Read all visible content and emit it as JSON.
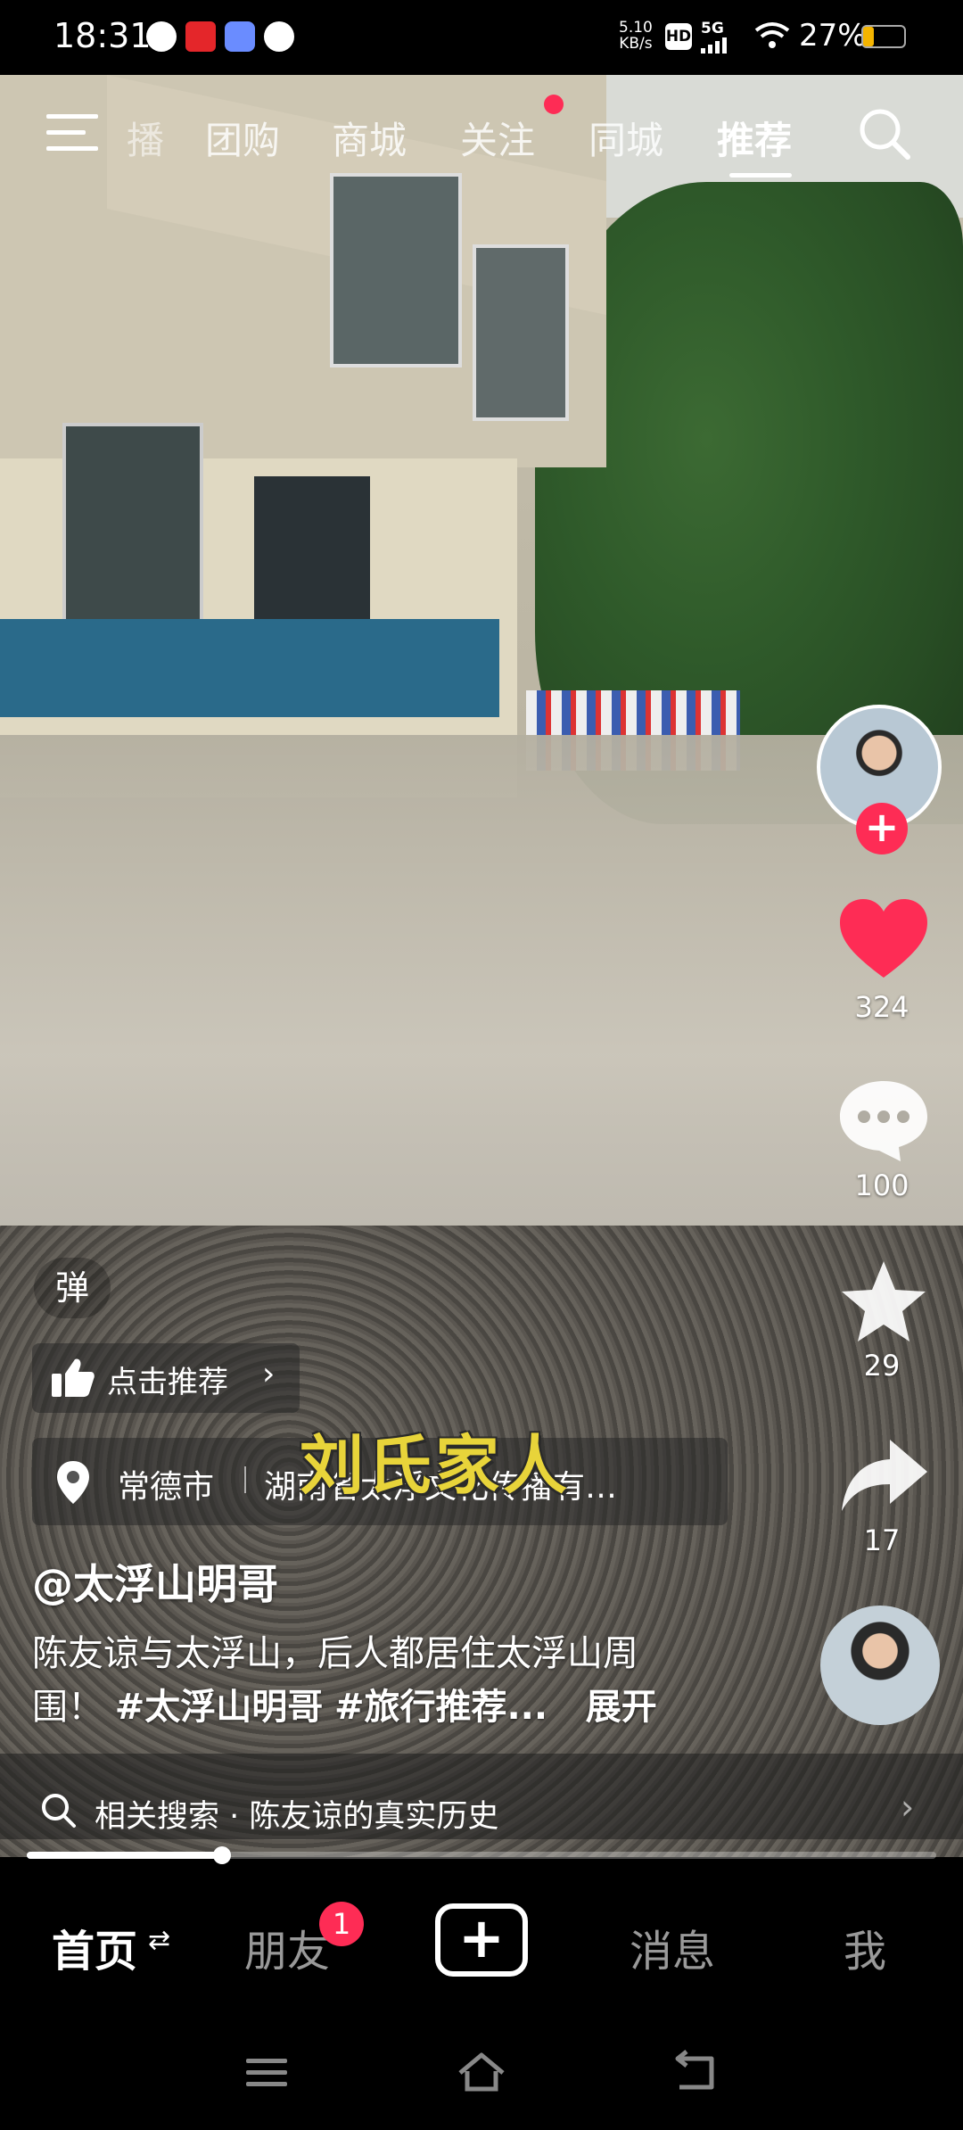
{
  "status_bar": {
    "time": "18:31",
    "net_speed_value": "5.10",
    "net_speed_unit": "KB/s",
    "hd_label": "HD",
    "network_label": "5G",
    "battery_percent": "27%",
    "battery_level": 0.27
  },
  "top_nav": {
    "tabs": [
      {
        "label": "播"
      },
      {
        "label": "团购"
      },
      {
        "label": "商城"
      },
      {
        "label": "关注"
      },
      {
        "label": "同城"
      },
      {
        "label": "推荐"
      }
    ],
    "active_tab": "推荐"
  },
  "video": {
    "subtitle": "刘氏家人"
  },
  "actions": {
    "like_count": "324",
    "comment_count": "100",
    "favorite_count": "29",
    "share_count": "17",
    "follow_plus": "+"
  },
  "info": {
    "danmu_label": "弹",
    "recommend_label": "点击推荐",
    "recommend_chevron": "›",
    "location_city": "常德市",
    "location_company": "湖南省太浮文化传播有…",
    "author_name": "@太浮山明哥",
    "caption_line1": "陈友谅与太浮山，后人都居住太浮山周",
    "caption_line2_prefix": "围！",
    "hashtag1": "#太浮山明哥",
    "hashtag2": "#旅行推荐...",
    "expand_label": "展开"
  },
  "related_search": {
    "label": "相关搜索 · 陈友谅的真实历史",
    "chevron": "›"
  },
  "playback": {
    "progress": 0.215
  },
  "bottom_tabs": {
    "home": "首页",
    "home_swap_icon": "⇄",
    "friends": "朋友",
    "friends_badge": "1",
    "create": "+",
    "messages": "消息",
    "me": "我"
  },
  "colors": {
    "accent": "#fe2c55",
    "subtitle": "#e8d43a",
    "battery": "#f4b400"
  }
}
